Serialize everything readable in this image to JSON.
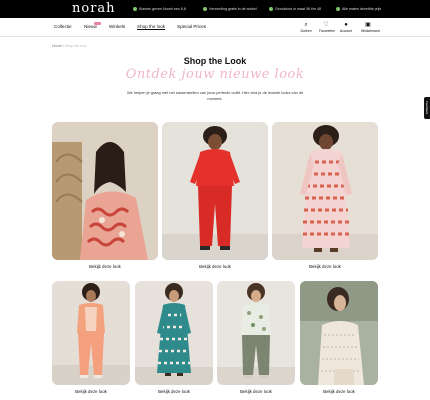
{
  "header": {
    "logo": "norah",
    "usps": [
      "Klanten geven Norah een 8,8",
      "Verzending gratis in de winkel",
      "Geruisloos in maat 36 t/m 48",
      "Alle maten dezelfde prijs"
    ]
  },
  "nav": {
    "items": [
      "Collectie",
      "Nieuw",
      "Winkels",
      "Shop the look",
      "Special Prices"
    ],
    "icons": [
      {
        "label": "Zoeken",
        "icon": "search-icon"
      },
      {
        "label": "Favorieten",
        "icon": "heart-icon"
      },
      {
        "label": "Account",
        "icon": "user-icon"
      },
      {
        "label": "Winkelmand",
        "icon": "bag-icon"
      }
    ]
  },
  "breadcrumb": {
    "home": "Home",
    "sep": "/",
    "current": "Shop the look"
  },
  "page": {
    "title": "Shop the Look",
    "subtitle": "Ontdek jouw nieuwe look",
    "intro": "We helpen je graag met het samenstellen van jouw perfecte outfit. Hier vind je de leukste looks van dit moment."
  },
  "looks": [
    {
      "cta": "Bekijk deze look"
    },
    {
      "cta": "Bekijk deze look"
    },
    {
      "cta": "Bekijk deze look"
    },
    {
      "cta": "Bekijk deze look"
    },
    {
      "cta": "Bekijk deze look"
    },
    {
      "cta": "Bekijk deze look"
    },
    {
      "cta": "Bekijk deze look"
    }
  ],
  "feedback": "Feedback",
  "colors": {
    "accent_pink": "#f0b6c9",
    "check_green": "#7fc26b",
    "new_badge": "#e87f9d"
  }
}
